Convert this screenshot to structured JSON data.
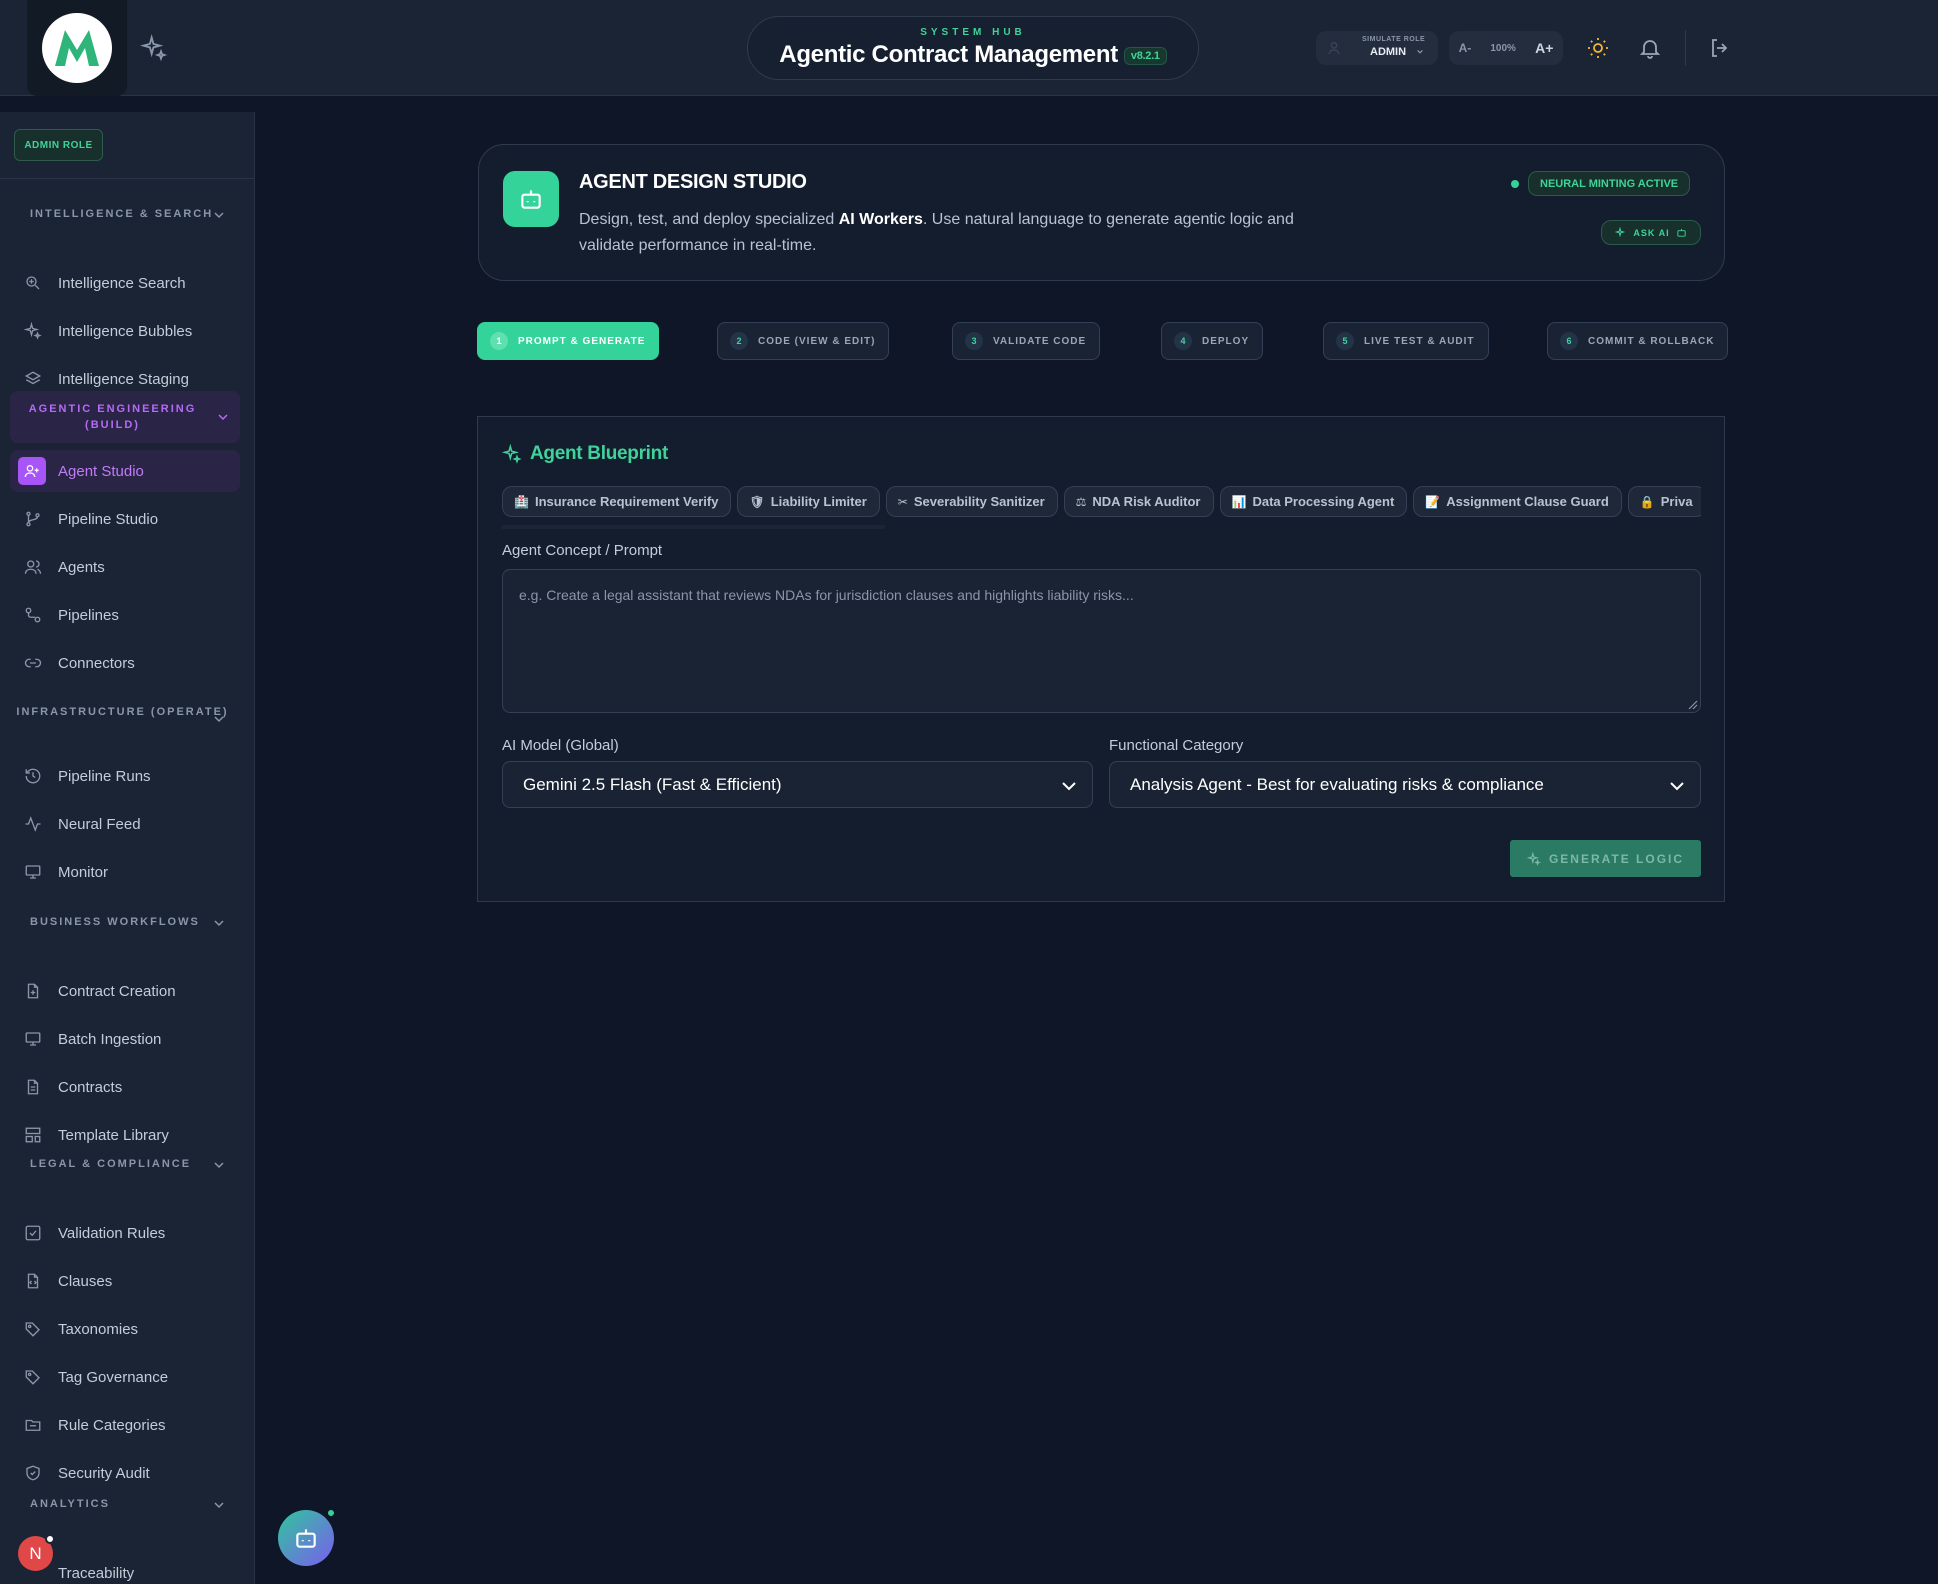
{
  "header": {
    "eyebrow": "SYSTEM HUB",
    "title": "Agentic Contract Management",
    "version": "v8.2.1",
    "simulate_role_label": "SIMULATE ROLE",
    "simulate_role_value": "ADMIN",
    "zoom_minus": "A-",
    "zoom_level": "100%",
    "zoom_plus": "A+"
  },
  "sidebar": {
    "role_badge": "ADMIN ROLE",
    "sections": {
      "intelligence": "INTELLIGENCE & SEARCH",
      "agentic": "AGENTIC ENGINEERING (BUILD)",
      "infrastructure": "INFRASTRUCTURE (OPERATE)",
      "business": "BUSINESS WORKFLOWS",
      "legal": "LEGAL & COMPLIANCE",
      "analytics": "ANALYTICS"
    },
    "items": {
      "intelligence_search": "Intelligence Search",
      "intelligence_bubbles": "Intelligence Bubbles",
      "intelligence_staging": "Intelligence Staging",
      "agent_studio": "Agent Studio",
      "pipeline_studio": "Pipeline Studio",
      "agents": "Agents",
      "pipelines": "Pipelines",
      "connectors": "Connectors",
      "pipeline_runs": "Pipeline Runs",
      "neural_feed": "Neural Feed",
      "monitor": "Monitor",
      "contract_creation": "Contract Creation",
      "batch_ingestion": "Batch Ingestion",
      "contracts": "Contracts",
      "template_library": "Template Library",
      "validation_rules": "Validation Rules",
      "clauses": "Clauses",
      "taxonomies": "Taxonomies",
      "tag_governance": "Tag Governance",
      "rule_categories": "Rule Categories",
      "security_audit": "Security Audit",
      "traceability": "Traceability"
    },
    "avatar_initial": "N"
  },
  "hero": {
    "title": "AGENT DESIGN STUDIO",
    "desc_before": "Design, test, and deploy specialized ",
    "desc_bold": "AI Workers",
    "desc_after": ". Use natural language to generate agentic logic and validate performance in real-time.",
    "status": "NEURAL MINTING ACTIVE",
    "ask_ai": "ASK AI"
  },
  "steps": [
    {
      "n": "1",
      "label": "PROMPT & GENERATE"
    },
    {
      "n": "2",
      "label": "CODE (VIEW & EDIT)"
    },
    {
      "n": "3",
      "label": "VALIDATE CODE"
    },
    {
      "n": "4",
      "label": "DEPLOY"
    },
    {
      "n": "5",
      "label": "LIVE TEST & AUDIT"
    },
    {
      "n": "6",
      "label": "COMMIT & ROLLBACK"
    }
  ],
  "blueprint": {
    "title": "Agent Blueprint",
    "chips": [
      {
        "emoji": "🏥",
        "label": "Insurance Requirement Verify"
      },
      {
        "emoji": "🛡",
        "label": "Liability Limiter"
      },
      {
        "emoji": "✂",
        "label": "Severability Sanitizer"
      },
      {
        "emoji": "⚖",
        "label": "NDA Risk Auditor"
      },
      {
        "emoji": "📊",
        "label": "Data Processing Agent"
      },
      {
        "emoji": "📝",
        "label": "Assignment Clause Guard"
      },
      {
        "emoji": "🔒",
        "label": "Priva"
      }
    ],
    "prompt_label": "Agent Concept / Prompt",
    "prompt_placeholder": "e.g. Create a legal assistant that reviews NDAs for jurisdiction clauses and highlights liability risks...",
    "model_label": "AI Model (Global)",
    "model_value": "Gemini 2.5 Flash (Fast & Efficient)",
    "category_label": "Functional Category",
    "category_value": "Analysis Agent - Best for evaluating risks & compliance",
    "generate_label": "GENERATE LOGIC"
  },
  "colors": {
    "accent": "#34d39a",
    "purple": "#a855f7",
    "background": "#0f1628",
    "panel": "#1b2434"
  }
}
